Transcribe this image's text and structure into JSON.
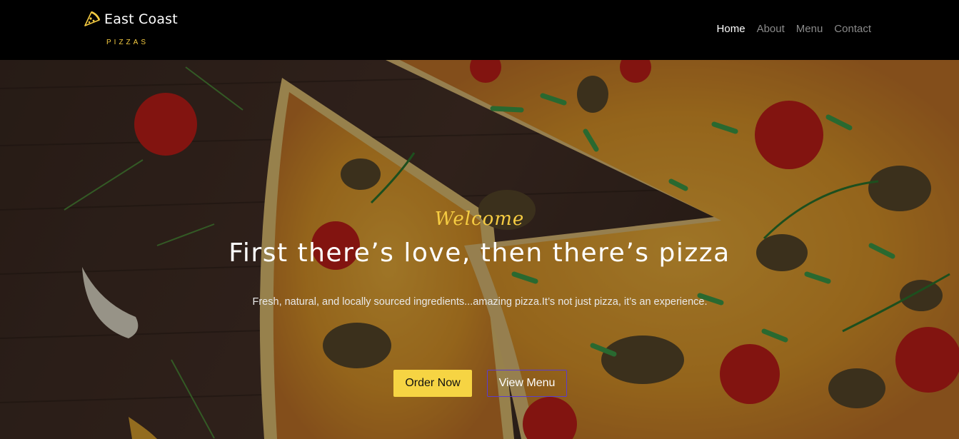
{
  "brand": {
    "name": "East Coast",
    "sub": "PIZZAS",
    "icon": "pizza-slice-icon",
    "accent": "#f6cc42"
  },
  "nav": {
    "items": [
      {
        "label": "Home",
        "active": true
      },
      {
        "label": "About",
        "active": false
      },
      {
        "label": "Menu",
        "active": false
      },
      {
        "label": "Contact",
        "active": false
      }
    ]
  },
  "hero": {
    "welcome": "Welcome",
    "headline": "First there’s love, then there’s pizza",
    "subtext": "Fresh, natural, and locally sourced ingredients...amazing pizza.It’s not just pizza, it’s an experience.",
    "buttons": {
      "order_label": "Order Now",
      "menu_label": "View Menu"
    },
    "colors": {
      "order_bg": "#f6d443",
      "menu_border": "#5b3ccf"
    }
  }
}
